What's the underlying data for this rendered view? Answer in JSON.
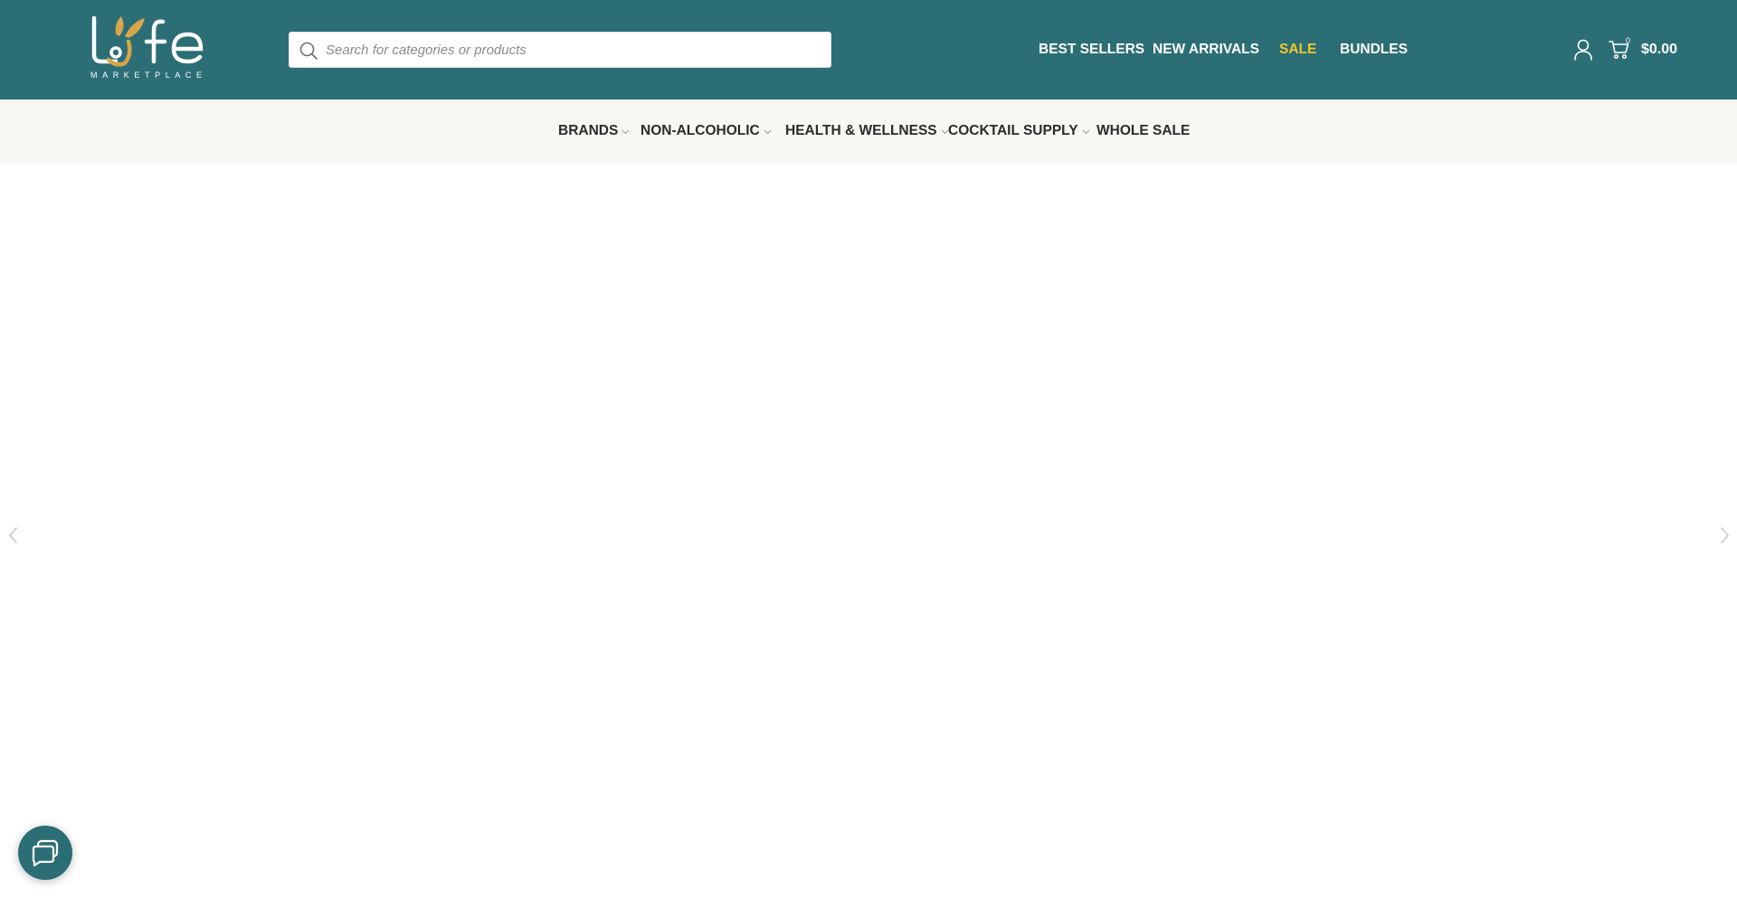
{
  "brand": {
    "logo_subtitle": "MARKETPLACE",
    "colors": {
      "primary": "#2c6e75",
      "accent": "#f0c92c",
      "gold": "#d7a64a",
      "category_bar": "#f8f7f4"
    }
  },
  "search": {
    "placeholder": "Search for categories or products",
    "value": "",
    "icon": "search-icon"
  },
  "top_nav": {
    "items": [
      {
        "label": "BEST SELLERS"
      },
      {
        "label": "NEW ARRIVALS"
      },
      {
        "label": "SALE"
      },
      {
        "label": "BUNDLES"
      }
    ]
  },
  "header_actions": {
    "account_icon": "user-icon",
    "cart_icon": "shopping-cart-icon",
    "cart_count": "0",
    "cart_total": "$0.00"
  },
  "category_nav": {
    "items": [
      {
        "label": "BRANDS",
        "has_dropdown": true
      },
      {
        "label": "NON-ALCOHOLIC",
        "has_dropdown": true
      },
      {
        "label": "HEALTH & WELLNESS",
        "has_dropdown": true
      },
      {
        "label": "COCKTAIL SUPPLY",
        "has_dropdown": true
      },
      {
        "label": "WHOLE SALE",
        "has_dropdown": false
      }
    ]
  },
  "slider": {
    "prev_icon": "chevron-left-icon",
    "next_icon": "chevron-right-icon"
  },
  "chat_widget": {
    "icon": "chat-bubble-icon"
  }
}
